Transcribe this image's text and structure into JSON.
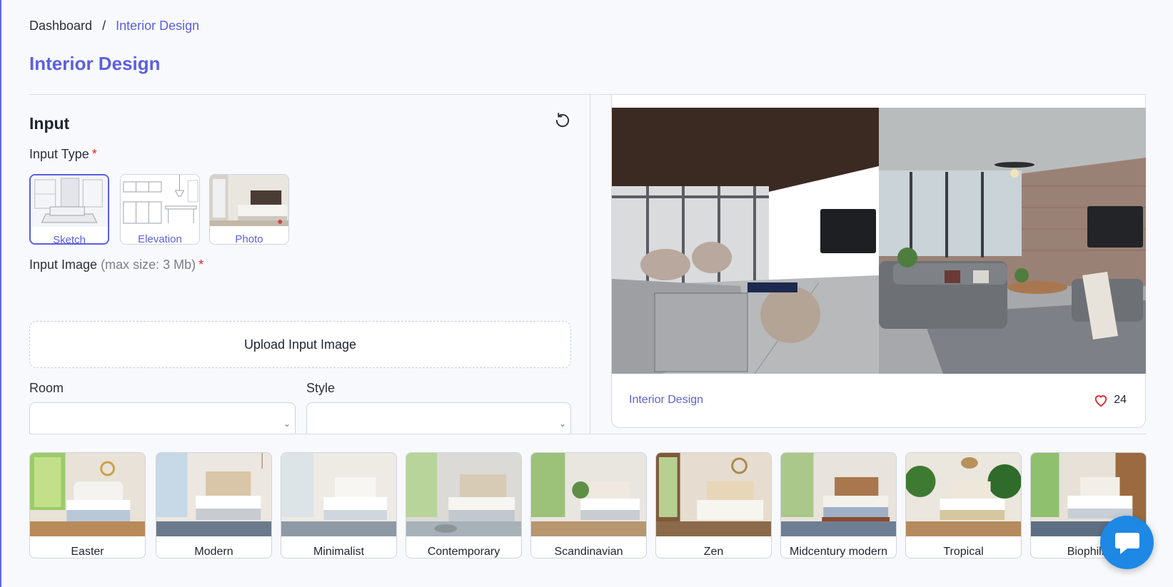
{
  "breadcrumb": {
    "home": "Dashboard",
    "separator": "/",
    "current": "Interior Design"
  },
  "page_title": "Interior Design",
  "input": {
    "heading": "Input",
    "input_type_label": "Input Type",
    "required_mark": "*",
    "types": [
      {
        "label": "Sketch",
        "selected": true
      },
      {
        "label": "Elevation",
        "selected": false
      },
      {
        "label": "Photo",
        "selected": false
      }
    ],
    "input_image_label": "Input Image",
    "input_image_hint": "(max size: 3 Mb)",
    "upload_label": "Upload Input Image",
    "room_label": "Room",
    "style_label": "Style",
    "room_value": "",
    "style_value": ""
  },
  "preview": {
    "tag": "Interior Design",
    "likes": "24"
  },
  "styles": [
    "Easter",
    "Modern",
    "Minimalist",
    "Contemporary",
    "Scandinavian",
    "Zen",
    "Midcentury modern",
    "Tropical",
    "Biophilic"
  ],
  "colors": {
    "accent": "#5b5fe0",
    "required": "#e02424",
    "chat": "#1e88e5"
  }
}
